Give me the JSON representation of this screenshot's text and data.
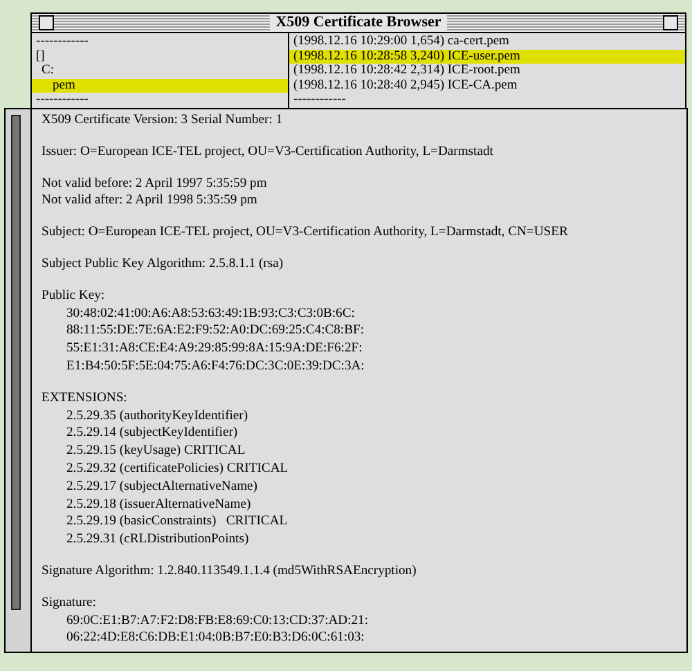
{
  "window": {
    "title": "X509 Certificate Browser"
  },
  "directories": [
    {
      "label": "------------",
      "selected": false
    },
    {
      "label": "[]",
      "selected": false,
      "children": [
        {
          "label": "C:",
          "selected": false,
          "children": [
            {
              "label": "pem",
              "selected": true
            }
          ]
        }
      ]
    },
    {
      "label": "------------",
      "selected": false
    }
  ],
  "files": [
    {
      "label": "(1998.12.16 10:29:00 1,654) ca-cert.pem",
      "selected": false
    },
    {
      "label": "(1998.12.16 10:28:58 3,240) ICE-user.pem",
      "selected": true
    },
    {
      "label": "(1998.12.16 10:28:42 2,314) ICE-root.pem",
      "selected": false
    },
    {
      "label": "(1998.12.16 10:28:40 2,945) ICE-CA.pem",
      "selected": false
    },
    {
      "label": "------------",
      "selected": false
    }
  ],
  "details": [
    {
      "lines": [
        "X509 Certificate Version: 3 Serial Number: 1"
      ]
    },
    {
      "lines": [
        "Issuer: O=European ICE-TEL project, OU=V3-Certification Authority, L=Darmstadt"
      ]
    },
    {
      "lines": [
        "Not valid before: 2 April 1997 5:35:59 pm",
        "Not valid after: 2 April 1998 5:35:59 pm"
      ]
    },
    {
      "lines": [
        "Subject: O=European ICE-TEL project, OU=V3-Certification Authority, L=Darmstadt, CN=USER"
      ]
    },
    {
      "lines": [
        "Subject Public Key Algorithm: 2.5.8.1.1 (rsa)"
      ]
    },
    {
      "lines": [
        "Public Key:"
      ],
      "items": [
        "30:48:02:41:00:A6:A8:53:63:49:1B:93:C3:C3:0B:6C:",
        "88:11:55:DE:7E:6A:E2:F9:52:A0:DC:69:25:C4:C8:BF:",
        "55:E1:31:A8:CE:E4:A9:29:85:99:8A:15:9A:DE:F6:2F:",
        "E1:B4:50:5F:5E:04:75:A6:F4:76:DC:3C:0E:39:DC:3A:"
      ]
    },
    {
      "lines": [
        "EXTENSIONS:"
      ],
      "items": [
        "2.5.29.35 (authorityKeyIdentifier)",
        "2.5.29.14 (subjectKeyIdentifier)",
        "2.5.29.15 (keyUsage) CRITICAL",
        "2.5.29.32 (certificatePolicies) CRITICAL",
        "2.5.29.17 (subjectAlternativeName)",
        "2.5.29.18 (issuerAlternativeName)",
        "2.5.29.19 (basicConstraints)   CRITICAL",
        "2.5.29.31 (cRLDistributionPoints)"
      ]
    },
    {
      "lines": [
        "Signature Algorithm: 1.2.840.113549.1.1.4 (md5WithRSAEncryption)"
      ]
    },
    {
      "lines": [
        "Signature:"
      ],
      "items": [
        "69:0C:E1:B7:A7:F2:D8:FB:E8:69:C0:13:CD:37:AD:21:",
        "06:22:4D:E8:C6:DB:E1:04:0B:B7:E0:B3:D6:0C:61:03:"
      ]
    }
  ]
}
